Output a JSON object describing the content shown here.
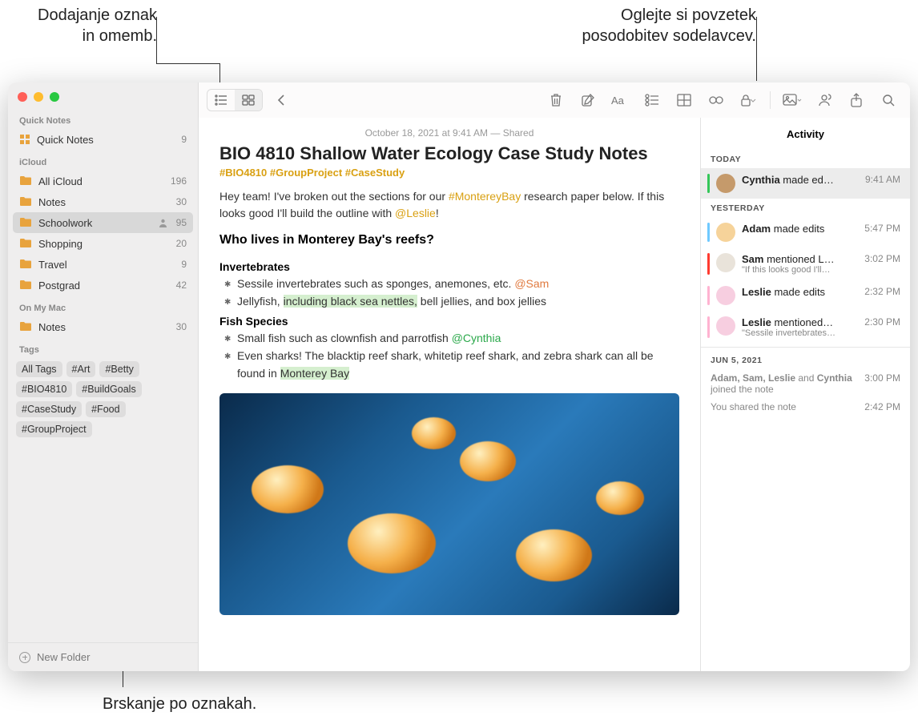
{
  "callouts": {
    "tagsMentions": "Dodajanje oznak\nin omemb.",
    "activitySummary": "Oglejte si povzetek\nposodobitev sodelavcev.",
    "browseTags": "Brskanje po oznakah."
  },
  "sidebar": {
    "sections": {
      "quickNotes": "Quick Notes",
      "icloud": "iCloud",
      "onMyMac": "On My Mac",
      "tags": "Tags"
    },
    "quickNotes": {
      "label": "Quick Notes",
      "count": "9"
    },
    "icloud": [
      {
        "label": "All iCloud",
        "count": "196",
        "shared": false
      },
      {
        "label": "Notes",
        "count": "30",
        "shared": false
      },
      {
        "label": "Schoolwork",
        "count": "95",
        "shared": true,
        "selected": true
      },
      {
        "label": "Shopping",
        "count": "20",
        "shared": false
      },
      {
        "label": "Travel",
        "count": "9",
        "shared": false
      },
      {
        "label": "Postgrad",
        "count": "42",
        "shared": false
      }
    ],
    "onMyMac": [
      {
        "label": "Notes",
        "count": "30"
      }
    ],
    "tags": [
      "All Tags",
      "#Art",
      "#Betty",
      "#BIO4810",
      "#BuildGoals",
      "#CaseStudy",
      "#Food",
      "#GroupProject"
    ],
    "newFolder": "New Folder"
  },
  "note": {
    "date": "October 18, 2021 at 9:41 AM — Shared",
    "title": "BIO 4810 Shallow Water Ecology Case Study Notes",
    "tagsLine": "#BIO4810 #GroupProject #CaseStudy",
    "intro1": "Hey team! I've broken out the sections for our ",
    "introHash": "#MontereyBay",
    "intro2": " research paper below. If this looks good I'll build the outline with ",
    "introMention": "@Leslie",
    "intro3": "!",
    "h2": "Who lives in Monterey Bay's reefs?",
    "sec1h": "Invertebrates",
    "sec1b1a": "Sessile invertebrates such as sponges, anemones, etc. ",
    "sec1b1m": "@Sam",
    "sec1b2a": "Jellyfish, ",
    "sec1b2hl": "including black sea nettles,",
    "sec1b2b": " bell jellies, and box jellies",
    "sec2h": "Fish Species",
    "sec2b1a": "Small fish such as clownfish and parrotfish ",
    "sec2b1m": "@Cynthia",
    "sec2b2a": "Even sharks! The blacktip reef shark, whitetip reef shark, and zebra shark can all be found in ",
    "sec2b2hl": "Monterey Bay"
  },
  "activity": {
    "heading": "Activity",
    "today": "TODAY",
    "yesterday": "YESTERDAY",
    "olderDate": "JUN 5, 2021",
    "items": {
      "today1": {
        "nameBold": "Cynthia",
        "rest": " made ed…",
        "time": "9:41 AM",
        "bar": "#34c759",
        "avatar": "#c59a6b"
      },
      "y1": {
        "nameBold": "Adam",
        "rest": " made edits",
        "time": "5:47 PM",
        "bar": "#6fc9ff",
        "avatar": "#f6d39a"
      },
      "y2": {
        "nameBold": "Sam",
        "rest": " mentioned L…",
        "sub": "\"If this looks good I'll…",
        "time": "3:02 PM",
        "bar": "#ff3b30",
        "avatar": "#e9e3da"
      },
      "y3": {
        "nameBold": "Leslie",
        "rest": " made edits",
        "time": "2:32 PM",
        "bar": "#ffb3d1",
        "avatar": "#f7cee0"
      },
      "y4": {
        "nameBold": "Leslie",
        "rest": " mentioned…",
        "sub": "\"Sessile invertebrates…",
        "time": "2:30 PM",
        "bar": "#ffb3d1",
        "avatar": "#f7cee0"
      }
    },
    "older1": {
      "text": "Adam, Sam, Leslie and Cynthia joined the note",
      "textB1": "Adam, Sam, Leslie",
      "textMid": " and ",
      "textB2": "Cynthia",
      "textEnd": " joined the note",
      "time": "3:00 PM"
    },
    "older2": {
      "text": "You shared the note",
      "time": "2:42 PM"
    }
  }
}
